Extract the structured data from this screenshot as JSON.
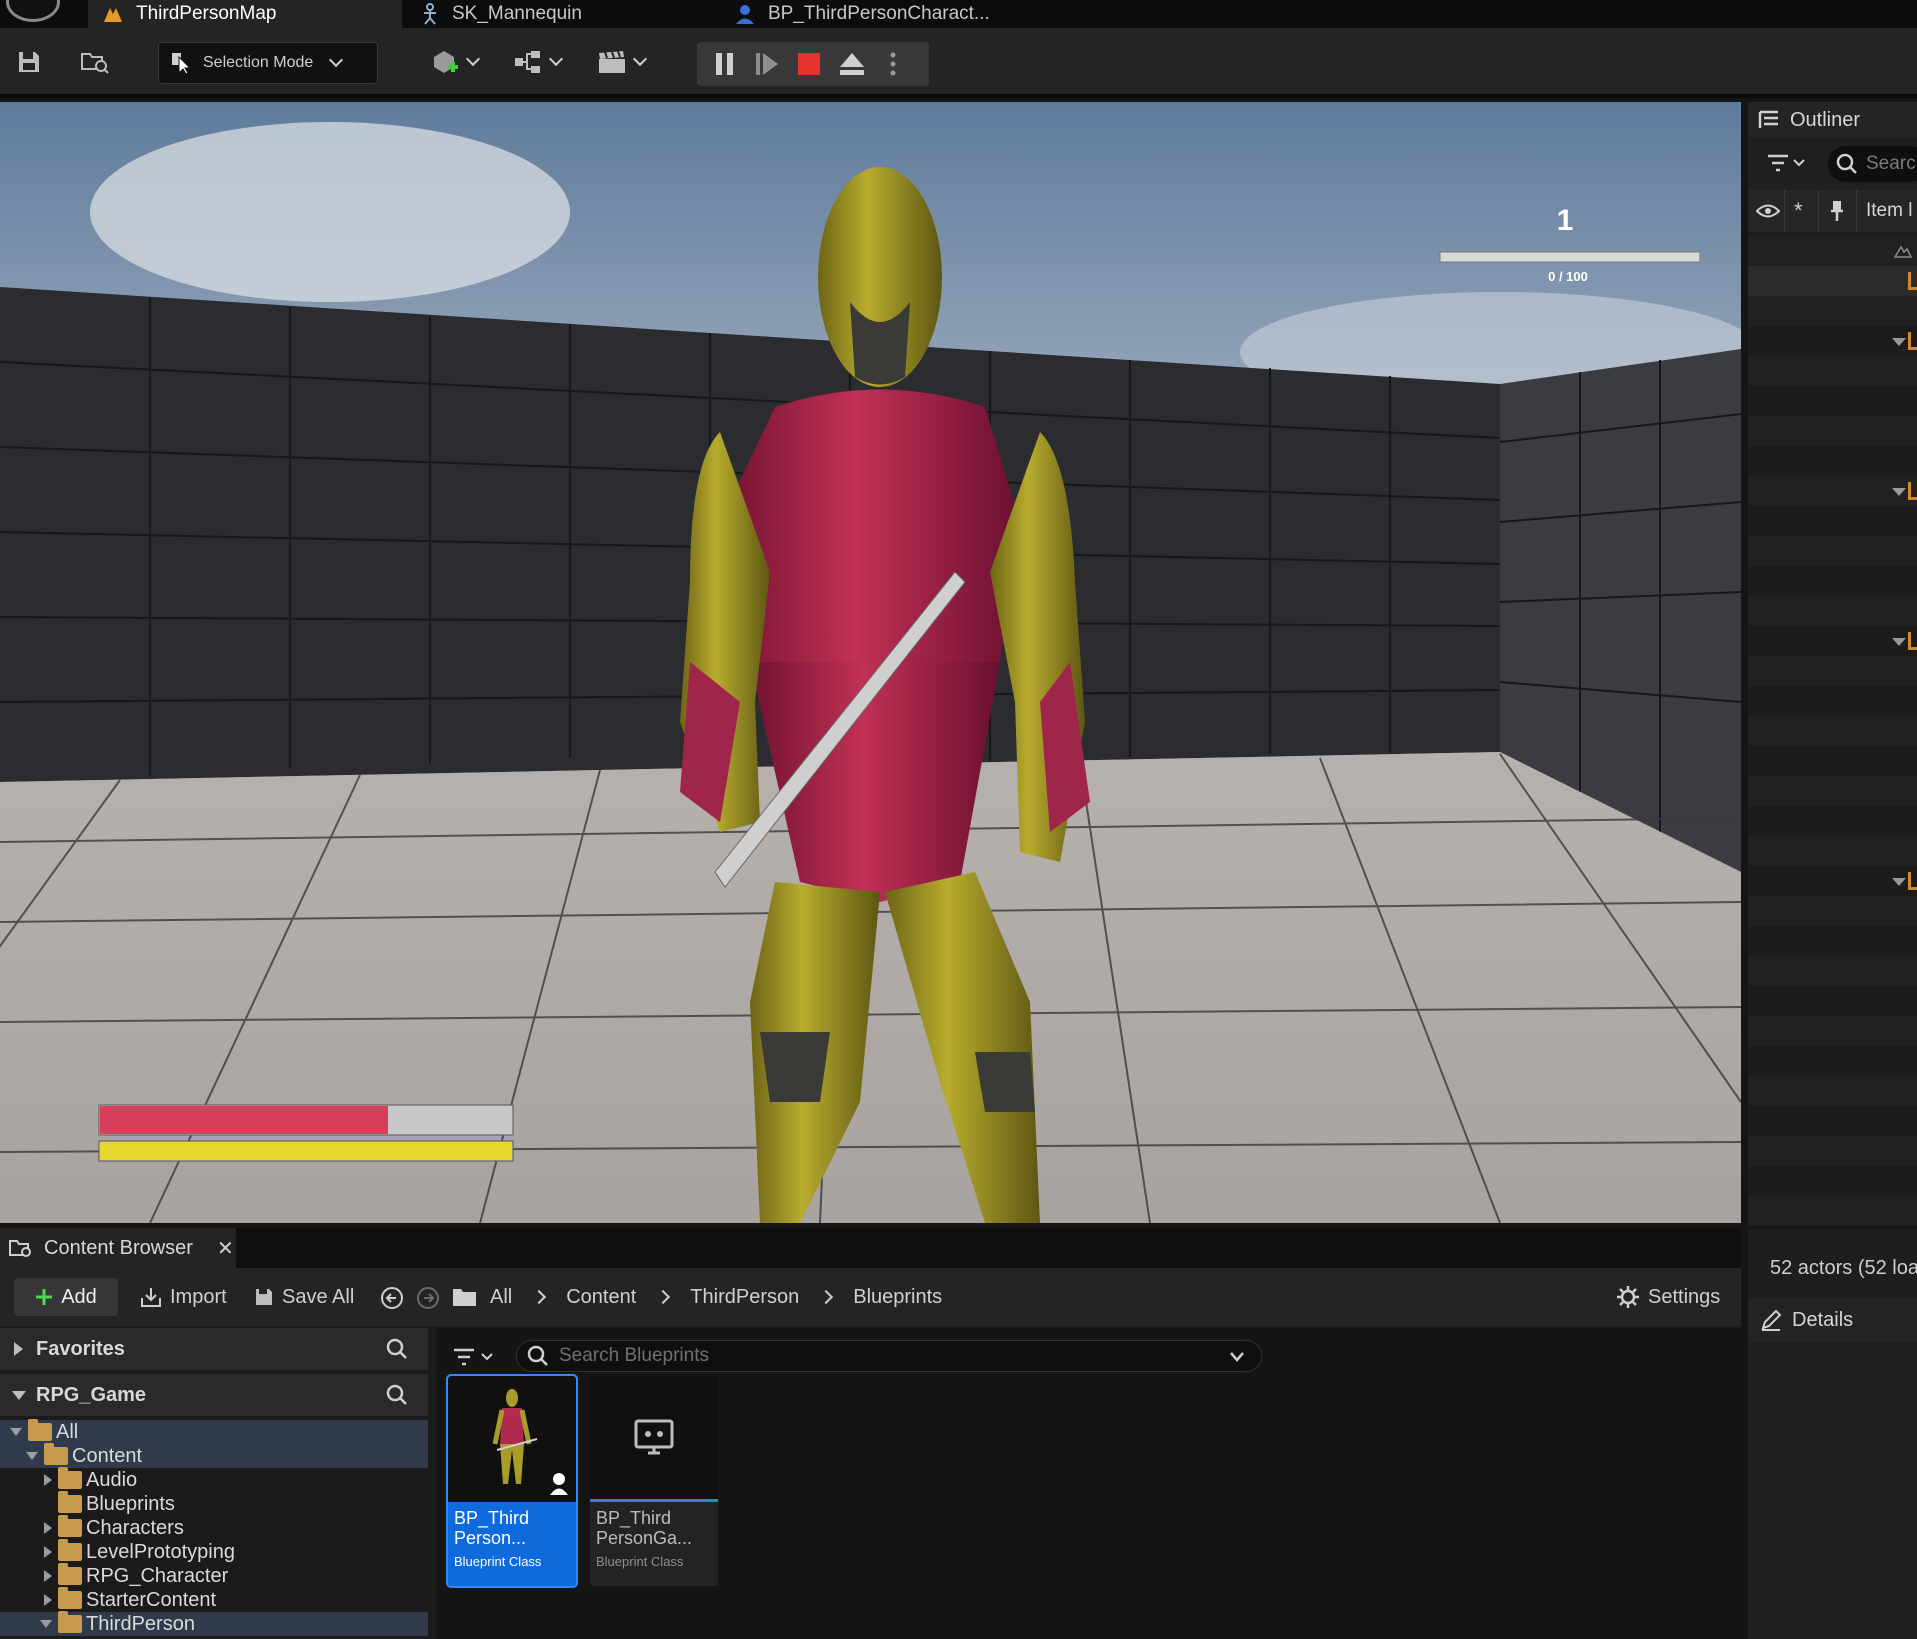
{
  "tabs": [
    {
      "label": "ThirdPersonMap"
    },
    {
      "label": "SK_Mannequin"
    },
    {
      "label": "BP_ThirdPersonCharact..."
    }
  ],
  "toolbar": {
    "selection_mode": "Selection Mode"
  },
  "viewport": {
    "hud_level": "1",
    "hud_xp": "0 / 100",
    "health_fraction": 0.7,
    "stamina_fraction": 1.0
  },
  "outliner": {
    "title": "Outliner",
    "search_placeholder": "Searc",
    "column_label": "Item l",
    "actors_status": "52 actors (52 loa"
  },
  "details": {
    "title": "Details"
  },
  "content_browser": {
    "tab_label": "Content Browser",
    "add_label": "Add",
    "import_label": "Import",
    "save_all_label": "Save All",
    "breadcrumb": [
      "All",
      "Content",
      "ThirdPerson",
      "Blueprints"
    ],
    "settings_label": "Settings",
    "search_placeholder": "Search Blueprints",
    "favorites_label": "Favorites",
    "project_label": "RPG_Game",
    "tree": [
      {
        "label": "All"
      },
      {
        "label": "Content"
      },
      {
        "label": "Audio"
      },
      {
        "label": "Blueprints"
      },
      {
        "label": "Characters"
      },
      {
        "label": "LevelPrototyping"
      },
      {
        "label": "RPG_Character"
      },
      {
        "label": "StarterContent"
      },
      {
        "label": "ThirdPerson"
      }
    ],
    "assets": [
      {
        "line1": "BP_Third",
        "line2": "Person...",
        "type": "Blueprint Class"
      },
      {
        "line1": "BP_Third",
        "line2": "PersonGa...",
        "type": "Blueprint Class"
      }
    ]
  },
  "colors": {
    "accent_blue": "#0f6bdc",
    "health_red": "#d8405a",
    "stamina_yellow": "#e6d82e",
    "folder": "#c79a4e",
    "stop_red": "#e8322e"
  }
}
